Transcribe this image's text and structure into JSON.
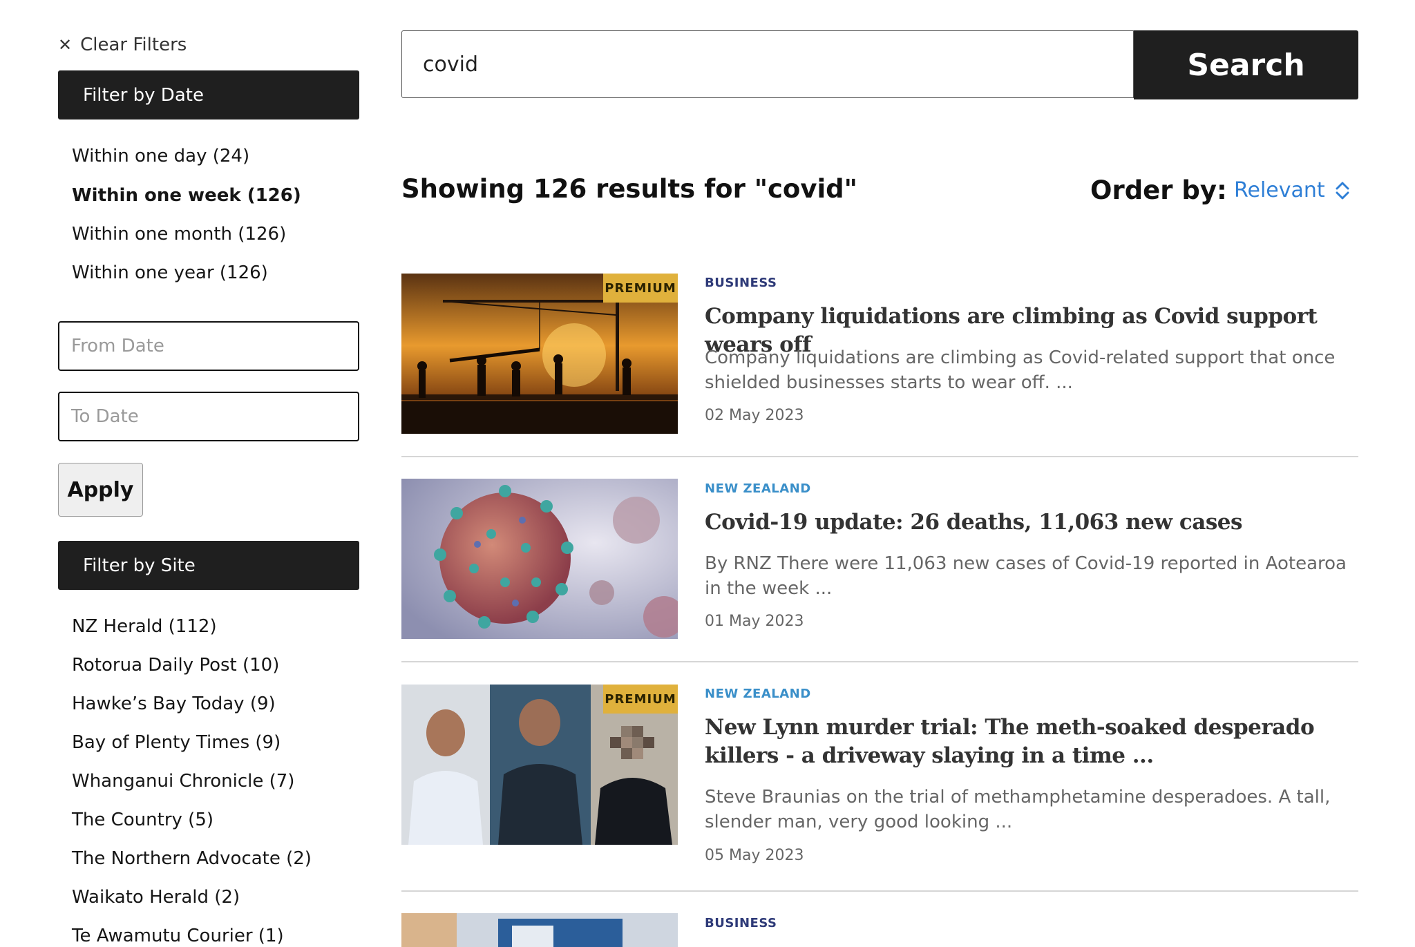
{
  "sidebar": {
    "clear_filters": "Clear Filters",
    "filter_by_date": "Filter by Date",
    "date_options": [
      "Within one day (24)",
      "Within one week (126)",
      "Within one month (126)",
      "Within one year (126)"
    ],
    "from_date_placeholder": "From Date",
    "to_date_placeholder": "To Date",
    "apply": "Apply",
    "filter_by_site": "Filter by Site",
    "site_options": [
      "NZ Herald (112)",
      "Rotorua Daily Post (10)",
      "Hawke’s Bay Today (9)",
      "Bay of Plenty Times (9)",
      "Whanganui Chronicle (7)",
      "The Country (5)",
      "The Northern Advocate (2)",
      "Waikato Herald (2)",
      "Te Awamutu Courier (1)"
    ]
  },
  "search": {
    "query": "covid",
    "button": "Search"
  },
  "results_header": {
    "count_text": "Showing 126 results for \"covid\"",
    "order_label": "Order by:",
    "order_value": "Relevant"
  },
  "results": [
    {
      "premium_badge": "PREMIUM",
      "category": "BUSINESS",
      "title": "Company liquidations are climbing as Covid support wears off",
      "summary": "Company liquidations are climbing as Covid-related support that once shielded businesses starts to wear off. ...",
      "date": "02 May 2023"
    },
    {
      "category": "NEW ZEALAND",
      "title": "Covid-19 update: 26 deaths, 11,063 new cases",
      "summary": "By RNZ There were 11,063 new cases of Covid-19 reported in Aotearoa in the week ...",
      "date": "01 May 2023"
    },
    {
      "premium_badge": "PREMIUM",
      "category": "NEW ZEALAND",
      "title": "New Lynn murder trial: The meth-soaked desperado killers - a driveway slaying in a time ...",
      "summary": "Steve Braunias on the trial of methamphetamine desperadoes. A tall, slender man, very good looking ...",
      "date": "05 May 2023"
    },
    {
      "category": "BUSINESS"
    }
  ],
  "colors": {
    "business_category": "#2e3a78",
    "nz_category": "#3a8fc9",
    "accent_link": "#2f7fd6",
    "premium_badge": "#e0b13c",
    "dark_bar": "#1f1f1f"
  },
  "icons": {
    "clear": "close-icon",
    "order": "sort-chevrons-icon"
  }
}
